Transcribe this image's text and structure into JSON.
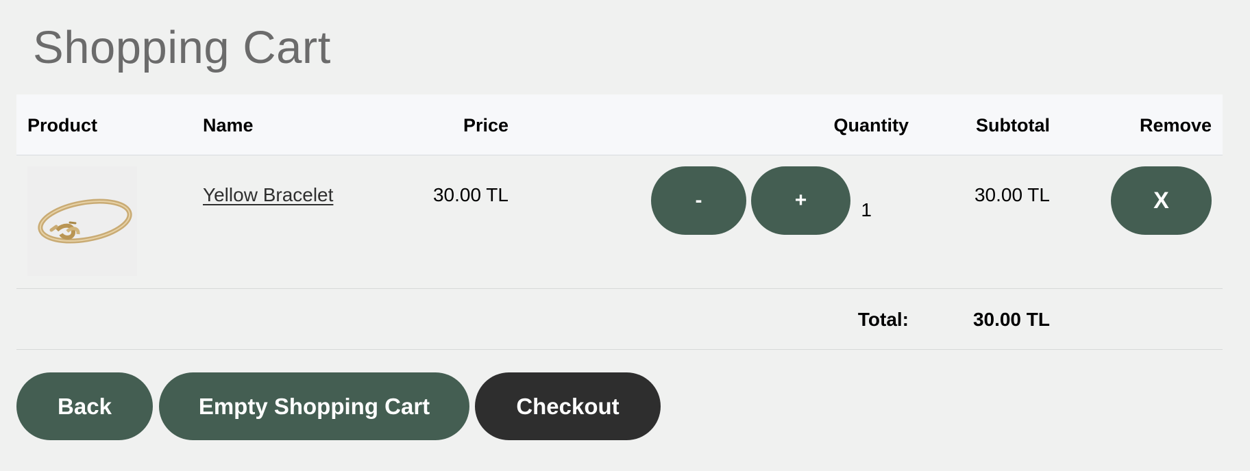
{
  "page": {
    "title": "Shopping Cart"
  },
  "table": {
    "headers": {
      "product": "Product",
      "name": "Name",
      "price": "Price",
      "quantity": "Quantity",
      "subtotal": "Subtotal",
      "remove": "Remove"
    },
    "items": [
      {
        "image": "gold-bracelet-product-image",
        "name": "Yellow Bracelet",
        "price": "30.00 TL",
        "decrease_label": "-",
        "increase_label": "+",
        "quantity": "1",
        "subtotal": "30.00 TL",
        "remove_label": "X"
      }
    ],
    "total": {
      "label": "Total:",
      "value": "30.00 TL"
    }
  },
  "actions": {
    "back_label": "Back",
    "empty_label": "Empty Shopping Cart",
    "checkout_label": "Checkout"
  },
  "colors": {
    "background": "#f0f1f0",
    "header_background": "#f7f8fa",
    "primary_button": "#445e52",
    "checkout_button": "#2e2e2e",
    "title_text": "#6b6b6b"
  }
}
